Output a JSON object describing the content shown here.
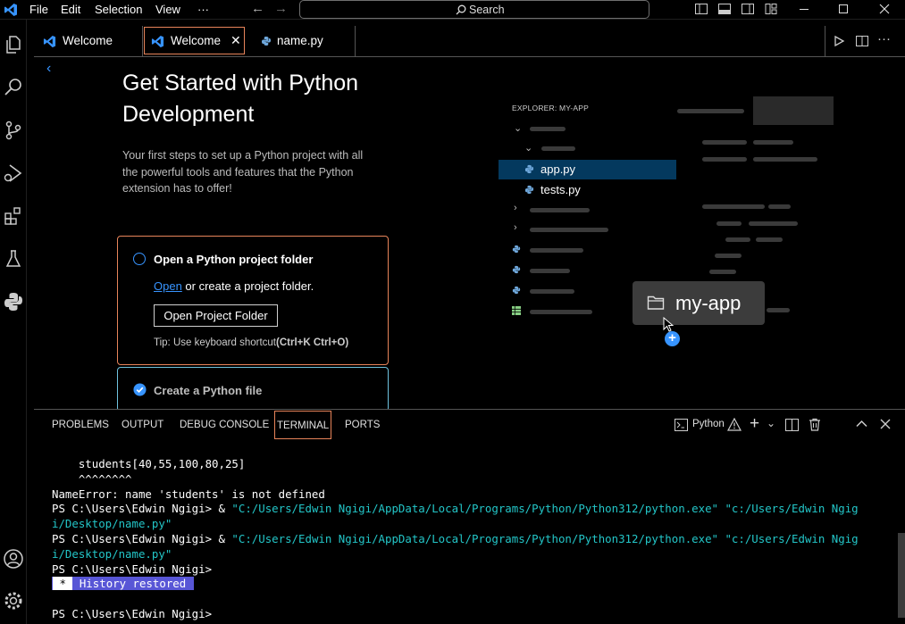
{
  "menu": {
    "items": [
      "File",
      "Edit",
      "Selection",
      "View",
      "···"
    ],
    "search_label": "Search"
  },
  "tabs": [
    {
      "label": "Welcome",
      "icon": "vscode-icon"
    },
    {
      "label": "Welcome",
      "icon": "vscode-icon",
      "active": true,
      "close": "✕"
    },
    {
      "label": "name.py",
      "icon": "python-icon"
    }
  ],
  "welcome": {
    "title": "Get Started with Python Development",
    "description": "Your first steps to set up a Python project with all the powerful tools and features that the Python extension has to offer!",
    "step1": {
      "title": "Open a Python project folder",
      "link": "Open",
      "text": " or create a project folder.",
      "button": "Open Project Folder",
      "tip_prefix": "Tip: Use keyboard shortcut",
      "tip_shortcut": "(Ctrl+K Ctrl+O)"
    },
    "step2": {
      "title": "Create a Python file"
    }
  },
  "mock_explorer": {
    "header": "EXPLORER: MY-APP",
    "files": [
      "app.py",
      "tests.py"
    ],
    "drag_label": "my-app"
  },
  "panel": {
    "tabs": [
      "PROBLEMS",
      "OUTPUT",
      "DEBUG CONSOLE",
      "TERMINAL",
      "PORTS"
    ],
    "active_tab": "TERMINAL",
    "terminal_profile": "Python"
  },
  "terminal": {
    "line1": "    students[40,55,100,80,25]",
    "line2": "    ^^^^^^^^",
    "line3": "NameError: name 'students' is not defined",
    "prompt": "PS C:\\Users\\Edwin Ngigi> & ",
    "cmd_a": "\"C:/Users/Edwin Ngigi/AppData/Local/Programs/Python/Python312/python.exe\" \"c:/Users/Edwin Ngig",
    "cmd_b": "i/Desktop/name.py\"",
    "prompt_plain": "PS C:\\Users\\Edwin Ngigi>",
    "history_star": " * ",
    "history": " History restored "
  },
  "colors": {
    "accent": "#3794ff",
    "highlight_border": "#e8845a",
    "terminal_cyan": "#23c6c8",
    "history_bg": "#5856d6"
  }
}
